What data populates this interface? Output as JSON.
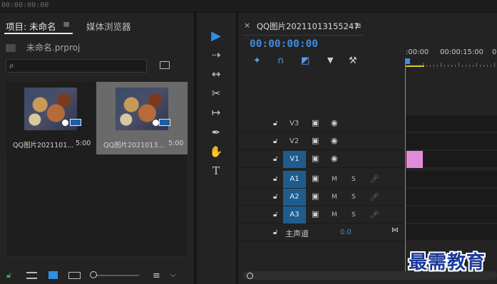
{
  "app": {
    "top_timecode": "00:00:00:00"
  },
  "project_panel": {
    "tab_active": "项目: 未命名",
    "tab_menu": "≡",
    "tab_other": "媒体浏览器",
    "project_file": "未命名.prproj",
    "search_placeholder": "",
    "clips": [
      {
        "name": "QQ图片2021101...",
        "duration": "5:00",
        "selected": false
      },
      {
        "name": "QQ图片2021013...",
        "duration": "5:00",
        "selected": true
      }
    ],
    "bottom_icons": [
      "lock-icon",
      "list-view-icon",
      "icon-view-icon",
      "freeform-view-icon",
      "zoom-slider",
      "sort-icon",
      "chevron-down-icon"
    ]
  },
  "tools": [
    "selection-tool",
    "track-select-tool",
    "ripple-edit-tool",
    "razor-tool",
    "slip-tool",
    "pen-tool",
    "hand-tool",
    "type-tool"
  ],
  "timeline": {
    "close": "×",
    "sequence_name": "QQ图片20211013155247",
    "menu": "≡",
    "timecode": "00:00:00:00",
    "ruler_labels": [
      ":00:00",
      "00:00:15:00",
      "00"
    ],
    "tracks": [
      {
        "id": "V3",
        "type": "video",
        "targeted": false
      },
      {
        "id": "V2",
        "type": "video",
        "targeted": false
      },
      {
        "id": "V1",
        "type": "video",
        "targeted": true
      },
      {
        "id": "A1",
        "type": "audio",
        "targeted": true
      },
      {
        "id": "A2",
        "type": "audio",
        "targeted": true
      },
      {
        "id": "A3",
        "type": "audio",
        "targeted": true
      }
    ],
    "mute_label": "M",
    "solo_label": "S",
    "master": {
      "label": "主声道",
      "value": "0.0"
    }
  },
  "watermark": "最需教育",
  "colors": {
    "accent": "#3d8de0",
    "clip_pink": "#e28bd9",
    "target_blue": "#1f5c8e",
    "work_area": "#d4c92a"
  }
}
